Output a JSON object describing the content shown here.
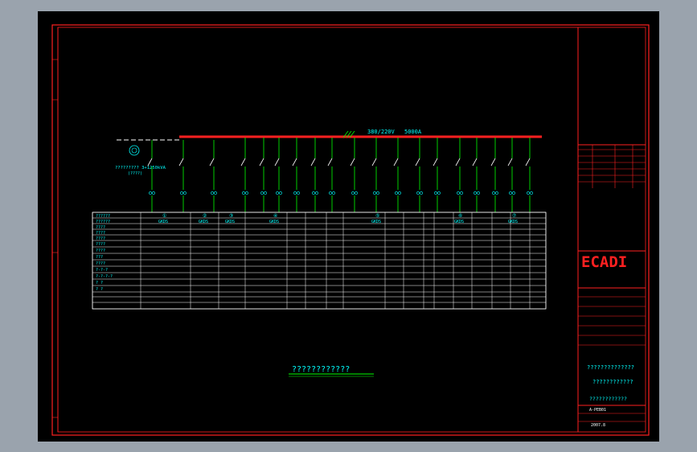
{
  "voltage_label": "380/220V",
  "busbar_current": "5000A",
  "transformer_label": "????????? 3+1250kVA",
  "transformer_sub": "(????)",
  "table": {
    "row_heads": [
      "??????",
      "??????",
      "????",
      "????",
      "????",
      "????",
      "????",
      "???",
      "????",
      "?-?-?",
      "?-?-?-?",
      "? ?",
      "? ?"
    ],
    "panels": [
      "①",
      "②",
      "③",
      "④",
      "⑤",
      "⑥",
      "⑦"
    ],
    "model": "GKDS"
  },
  "caption": "????????????",
  "title_block": {
    "logo": "ECADI",
    "drawing_title": "??????????????",
    "drawing_subtitle": "????????????",
    "drawing_name": "????????????",
    "drawing_no": "A-PEB01",
    "date": "2007.8"
  },
  "colors": {
    "background": "#000000",
    "border": "#ff2020",
    "text": "#00ffff",
    "wire": "#00ff00"
  }
}
